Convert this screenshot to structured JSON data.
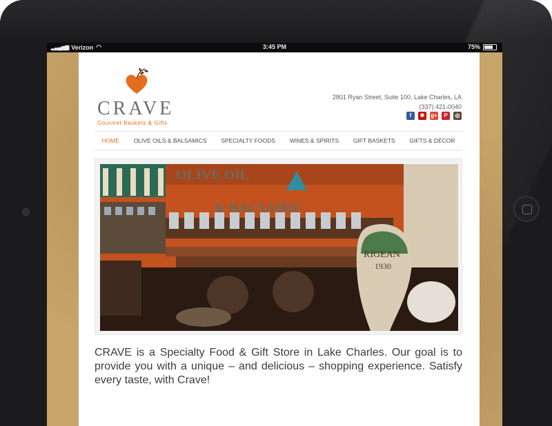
{
  "status_bar": {
    "carrier": "Verizon",
    "time": "3:45 PM",
    "battery": "75%",
    "battery_level": 0.75
  },
  "site": {
    "logo_word": "CRAVE",
    "tagline": "Gourmet Baskets & Gifts",
    "address": "2801 Ryan Street, Suite 100, Lake Charles, LA",
    "phone": "(337) 421-0040",
    "social": [
      {
        "name": "facebook-icon",
        "glyph": "f",
        "color": "#3b5998"
      },
      {
        "name": "yelp-icon",
        "glyph": "✱",
        "color": "#c41200"
      },
      {
        "name": "google-plus-icon",
        "glyph": "g+",
        "color": "#dd4b39"
      },
      {
        "name": "pinterest-icon",
        "glyph": "P",
        "color": "#cb2027"
      },
      {
        "name": "instagram-icon",
        "glyph": "◎",
        "color": "#5b4a3a"
      }
    ]
  },
  "nav": [
    {
      "label": "HOME",
      "active": true
    },
    {
      "label": "OLIVE OILS & BALSAMICS",
      "active": false
    },
    {
      "label": "SPECIALTY FOODS",
      "active": false
    },
    {
      "label": "WINES & SPIRITS",
      "active": false
    },
    {
      "label": "GIFT BASKETS",
      "active": false
    },
    {
      "label": "GIFTS & DÉCOR",
      "active": false
    }
  ],
  "hero": {
    "sign_text_1": "OLIVE OIL",
    "sign_text_2": "& BALSAMIC",
    "urn_text_1": "RIGEAN",
    "urn_text_2": "1930"
  },
  "intro_text": "CRAVE is a Specialty Food & Gift Store in Lake Charles. Our goal is to provide you with a unique – and delicious – shopping experience. Satisfy every taste, with Crave!",
  "colors": {
    "accent": "#e36f1e",
    "text": "#3b3b3b",
    "wall": "#c4521f"
  }
}
